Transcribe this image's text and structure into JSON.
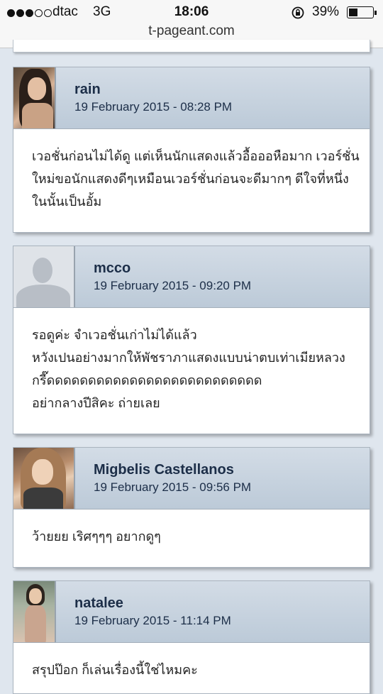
{
  "status_bar": {
    "signal_bars_filled": 3,
    "signal_bars_total": 5,
    "carrier": "dtac",
    "network": "3G",
    "time": "18:06",
    "battery_text": "39%",
    "battery_level": 0.39
  },
  "browser": {
    "url": "t-pageant.com"
  },
  "posts": [
    {
      "author": "rain",
      "date": "19 February 2015 - 08:28 PM",
      "lines": [
        "เวอชั่นก่อนไม่ได้ดู แต่เห็นนักแสดงแล้วอื้อออหือมาก เวอร์ชั่น",
        "ใหม่ขอนักแสดงดีๆเหมือนเวอร์ชั่นก่อนจะดีมากๆ ดีใจที่หนึ่ง",
        "ในนั้นเป็นอั้ม"
      ]
    },
    {
      "author": "mcco",
      "date": "19 February 2015 - 09:20 PM",
      "lines": [
        "รอดูค่ะ จำเวอชั่นเก่าไม่ได้แล้ว",
        "หวังเปนอย่างมากให้พัชราภาแสดงแบบน่าตบเท่าเมียหลวง",
        "กรี๊ดดดดดดดดดดดดดดดดดดดดดดดดดด",
        "อย่ากลางปีสิคะ ถ่ายเลย"
      ]
    },
    {
      "author": "Migbelis Castellanos",
      "date": "19 February 2015 - 09:56 PM",
      "lines": [
        "ว้ายยย เริศๆๆๆ อยากดูๆ"
      ]
    },
    {
      "author": "natalee",
      "date": "19 February 2015 - 11:14 PM",
      "lines": [
        "สรุปป๊อก ก็เล่นเรื่องนี้ใช่ไหมคะ"
      ]
    }
  ]
}
